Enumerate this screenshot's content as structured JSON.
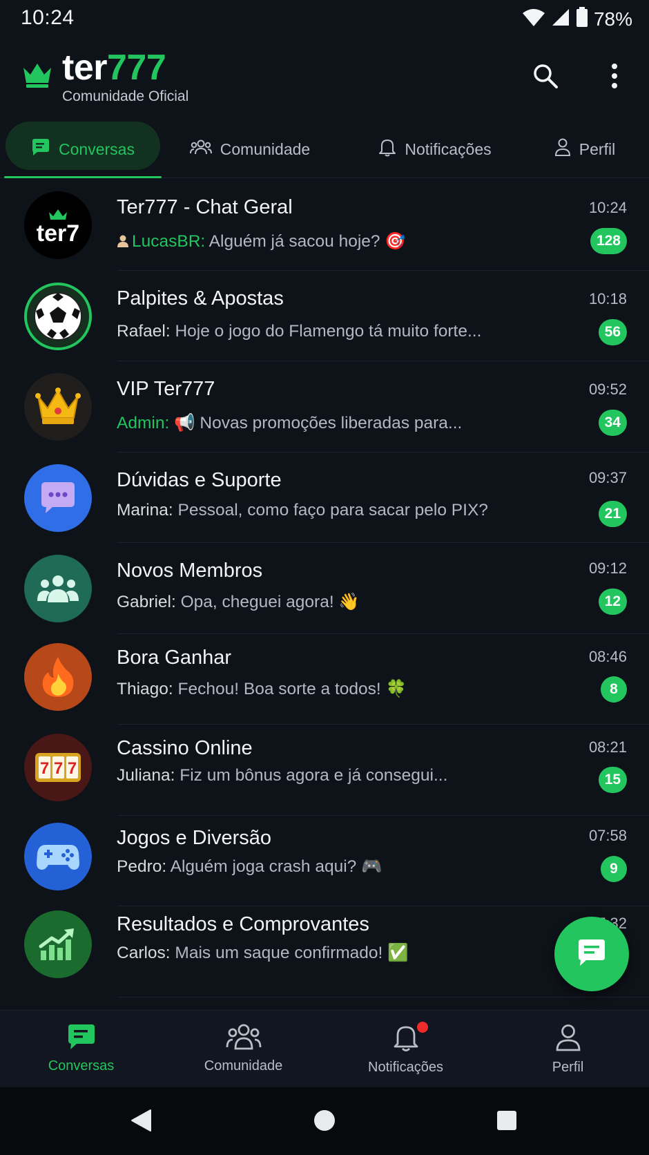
{
  "status_bar": {
    "time": "10:24",
    "battery": "78%"
  },
  "header": {
    "brand_part1": "ter",
    "brand_part2": "777",
    "subtitle": "Comunidade Oficial",
    "search_icon": "search-icon",
    "menu_icon": "more-vert-icon"
  },
  "tabs": [
    {
      "label": "Conversas",
      "icon": "chat-icon",
      "active": true
    },
    {
      "label": "Comunidade",
      "icon": "people-icon",
      "active": false
    },
    {
      "label": "Notificações",
      "icon": "bell-icon",
      "active": false
    },
    {
      "label": "Perfil",
      "icon": "person-icon",
      "active": false
    }
  ],
  "chats": [
    {
      "title": "Ter777 - Chat Geral",
      "sender": "LucasBR:",
      "message": " Alguém já sacou hoje? 🎯",
      "time": "10:24",
      "unread": "128",
      "avatar": "ter7-logo-avatar"
    },
    {
      "title": "Palpites & Apostas",
      "sender": "Rafael:",
      "message": " Hoje o jogo do Flamengo tá muito forte...",
      "time": "10:18",
      "unread": "56",
      "avatar": "soccer-ball-avatar"
    },
    {
      "title": "VIP Ter777",
      "sender": "Admin:",
      "message": " 📢 Novas promoções liberadas para...",
      "time": "09:52",
      "unread": "34",
      "avatar": "crown-avatar"
    },
    {
      "title": "Dúvidas e Suporte",
      "sender": "Marina:",
      "message": " Pessoal, como faço para sacar pelo PIX?",
      "time": "09:37",
      "unread": "21",
      "avatar": "chat-bubble-avatar"
    },
    {
      "title": "Novos Membros",
      "sender": "Gabriel:",
      "message": " Opa, cheguei agora! 👋",
      "time": "09:12",
      "unread": "12",
      "avatar": "group-avatar"
    },
    {
      "title": "Bora Ganhar",
      "sender": "Thiago:",
      "message": " Fechou! Boa sorte a todos! 🍀",
      "time": "08:46",
      "unread": "8",
      "avatar": "fire-avatar"
    },
    {
      "title": "Cassino Online",
      "sender": "Juliana:",
      "message": " Fiz um bônus agora e já consegui...",
      "time": "08:21",
      "unread": "15",
      "avatar": "slot-777-avatar"
    },
    {
      "title": "Jogos e Diversão",
      "sender": "Pedro:",
      "message": " Alguém joga crash aqui? 🎮",
      "time": "07:58",
      "unread": "9",
      "avatar": "gamepad-avatar"
    },
    {
      "title": "Resultados e Comprovantes",
      "sender": "Carlos:",
      "message": " Mais um saque confirmado! ✅",
      "time": "07:32",
      "unread": "",
      "avatar": "chart-up-avatar"
    }
  ],
  "bottom_nav": [
    {
      "label": "Conversas",
      "active": true
    },
    {
      "label": "Comunidade",
      "active": false
    },
    {
      "label": "Notificações",
      "active": false
    },
    {
      "label": "Perfil",
      "active": false
    }
  ],
  "colors": {
    "accent": "#22c55e",
    "background": "#0e1219",
    "badge_dot": "#ef2b2b"
  }
}
